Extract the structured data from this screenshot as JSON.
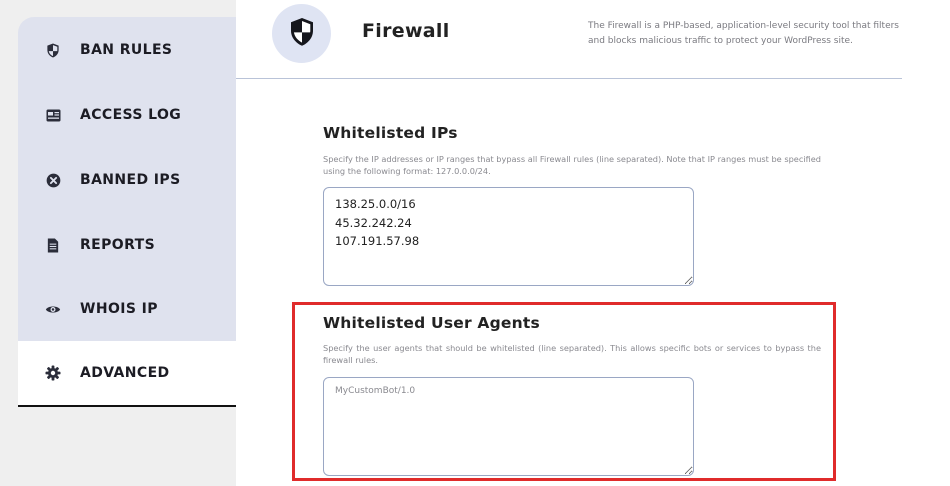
{
  "sidebar": {
    "items": [
      {
        "label": "BAN RULES",
        "icon": "shield-icon"
      },
      {
        "label": "ACCESS LOG",
        "icon": "id-card-icon"
      },
      {
        "label": "BANNED IPS",
        "icon": "circle-x-icon"
      },
      {
        "label": "REPORTS",
        "icon": "document-icon"
      },
      {
        "label": "WHOIS IP",
        "icon": "eye-icon"
      },
      {
        "label": "ADVANCED",
        "icon": "gear-icon",
        "active": true
      }
    ]
  },
  "header": {
    "title": "Firewall",
    "icon": "shield-icon",
    "description": "The Firewall is a PHP-based, application-level security tool that filters and blocks malicious traffic to protect your WordPress site."
  },
  "whitelisted_ips": {
    "title": "Whitelisted IPs",
    "help": "Specify the IP addresses or IP ranges that bypass all Firewall rules (line separated). Note that IP ranges must be specified using the following format: 127.0.0.0/24.",
    "value": "138.25.0.0/16\n45.32.242.24\n107.191.57.98"
  },
  "whitelisted_user_agents": {
    "title": "Whitelisted User Agents",
    "help": "Specify the user agents that should be whitelisted (line separated). This allows specific bots or services to bypass the firewall rules.",
    "value": "",
    "placeholder": "MyCustomBot/1.0"
  },
  "colors": {
    "sidebar_bg": "#dfe2ee",
    "highlight": "#e02b2b",
    "header_circle": "#dfe4f3"
  }
}
